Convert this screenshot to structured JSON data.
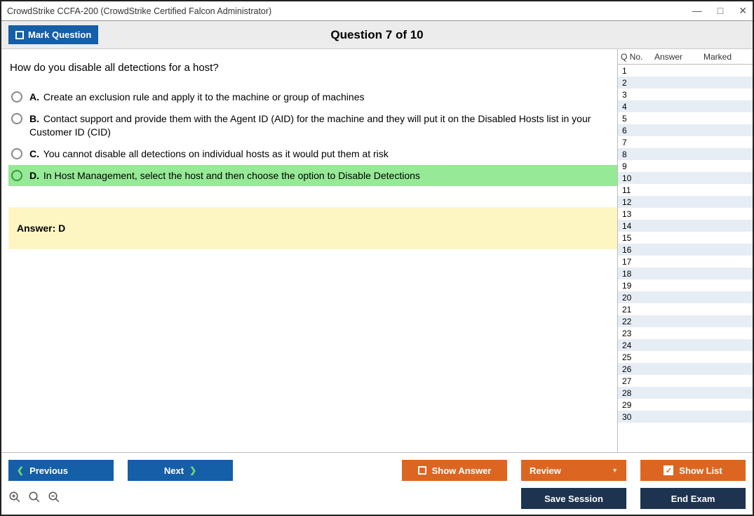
{
  "window": {
    "title": "CrowdStrike CCFA-200 (CrowdStrike Certified Falcon Administrator)"
  },
  "header": {
    "mark_label": "Mark Question",
    "question_title": "Question 7 of 10"
  },
  "question": {
    "text": "How do you disable all detections for a host?",
    "options": [
      {
        "letter": "A.",
        "text": "Create an exclusion rule and apply it to the machine or group of machines",
        "correct": false
      },
      {
        "letter": "B.",
        "text": "Contact support and provide them with the Agent ID (AID) for the machine and they will put it on the Disabled Hosts list in your Customer ID (CID)",
        "correct": false
      },
      {
        "letter": "C.",
        "text": "You cannot disable all detections on individual hosts as it would put them at risk",
        "correct": false
      },
      {
        "letter": "D.",
        "text": "In Host Management, select the host and then choose the option to Disable Detections",
        "correct": true
      }
    ],
    "answer_label": "Answer: D"
  },
  "sidebar": {
    "headers": {
      "qno": "Q No.",
      "answer": "Answer",
      "marked": "Marked"
    },
    "rows": [
      {
        "n": "1"
      },
      {
        "n": "2"
      },
      {
        "n": "3"
      },
      {
        "n": "4"
      },
      {
        "n": "5"
      },
      {
        "n": "6"
      },
      {
        "n": "7"
      },
      {
        "n": "8"
      },
      {
        "n": "9"
      },
      {
        "n": "10"
      },
      {
        "n": "11"
      },
      {
        "n": "12"
      },
      {
        "n": "13"
      },
      {
        "n": "14"
      },
      {
        "n": "15"
      },
      {
        "n": "16"
      },
      {
        "n": "17"
      },
      {
        "n": "18"
      },
      {
        "n": "19"
      },
      {
        "n": "20"
      },
      {
        "n": "21"
      },
      {
        "n": "22"
      },
      {
        "n": "23"
      },
      {
        "n": "24"
      },
      {
        "n": "25"
      },
      {
        "n": "26"
      },
      {
        "n": "27"
      },
      {
        "n": "28"
      },
      {
        "n": "29"
      },
      {
        "n": "30"
      }
    ]
  },
  "footer": {
    "previous": "Previous",
    "next": "Next",
    "show_answer": "Show Answer",
    "review": "Review",
    "show_list": "Show List",
    "save_session": "Save Session",
    "end_exam": "End Exam"
  }
}
